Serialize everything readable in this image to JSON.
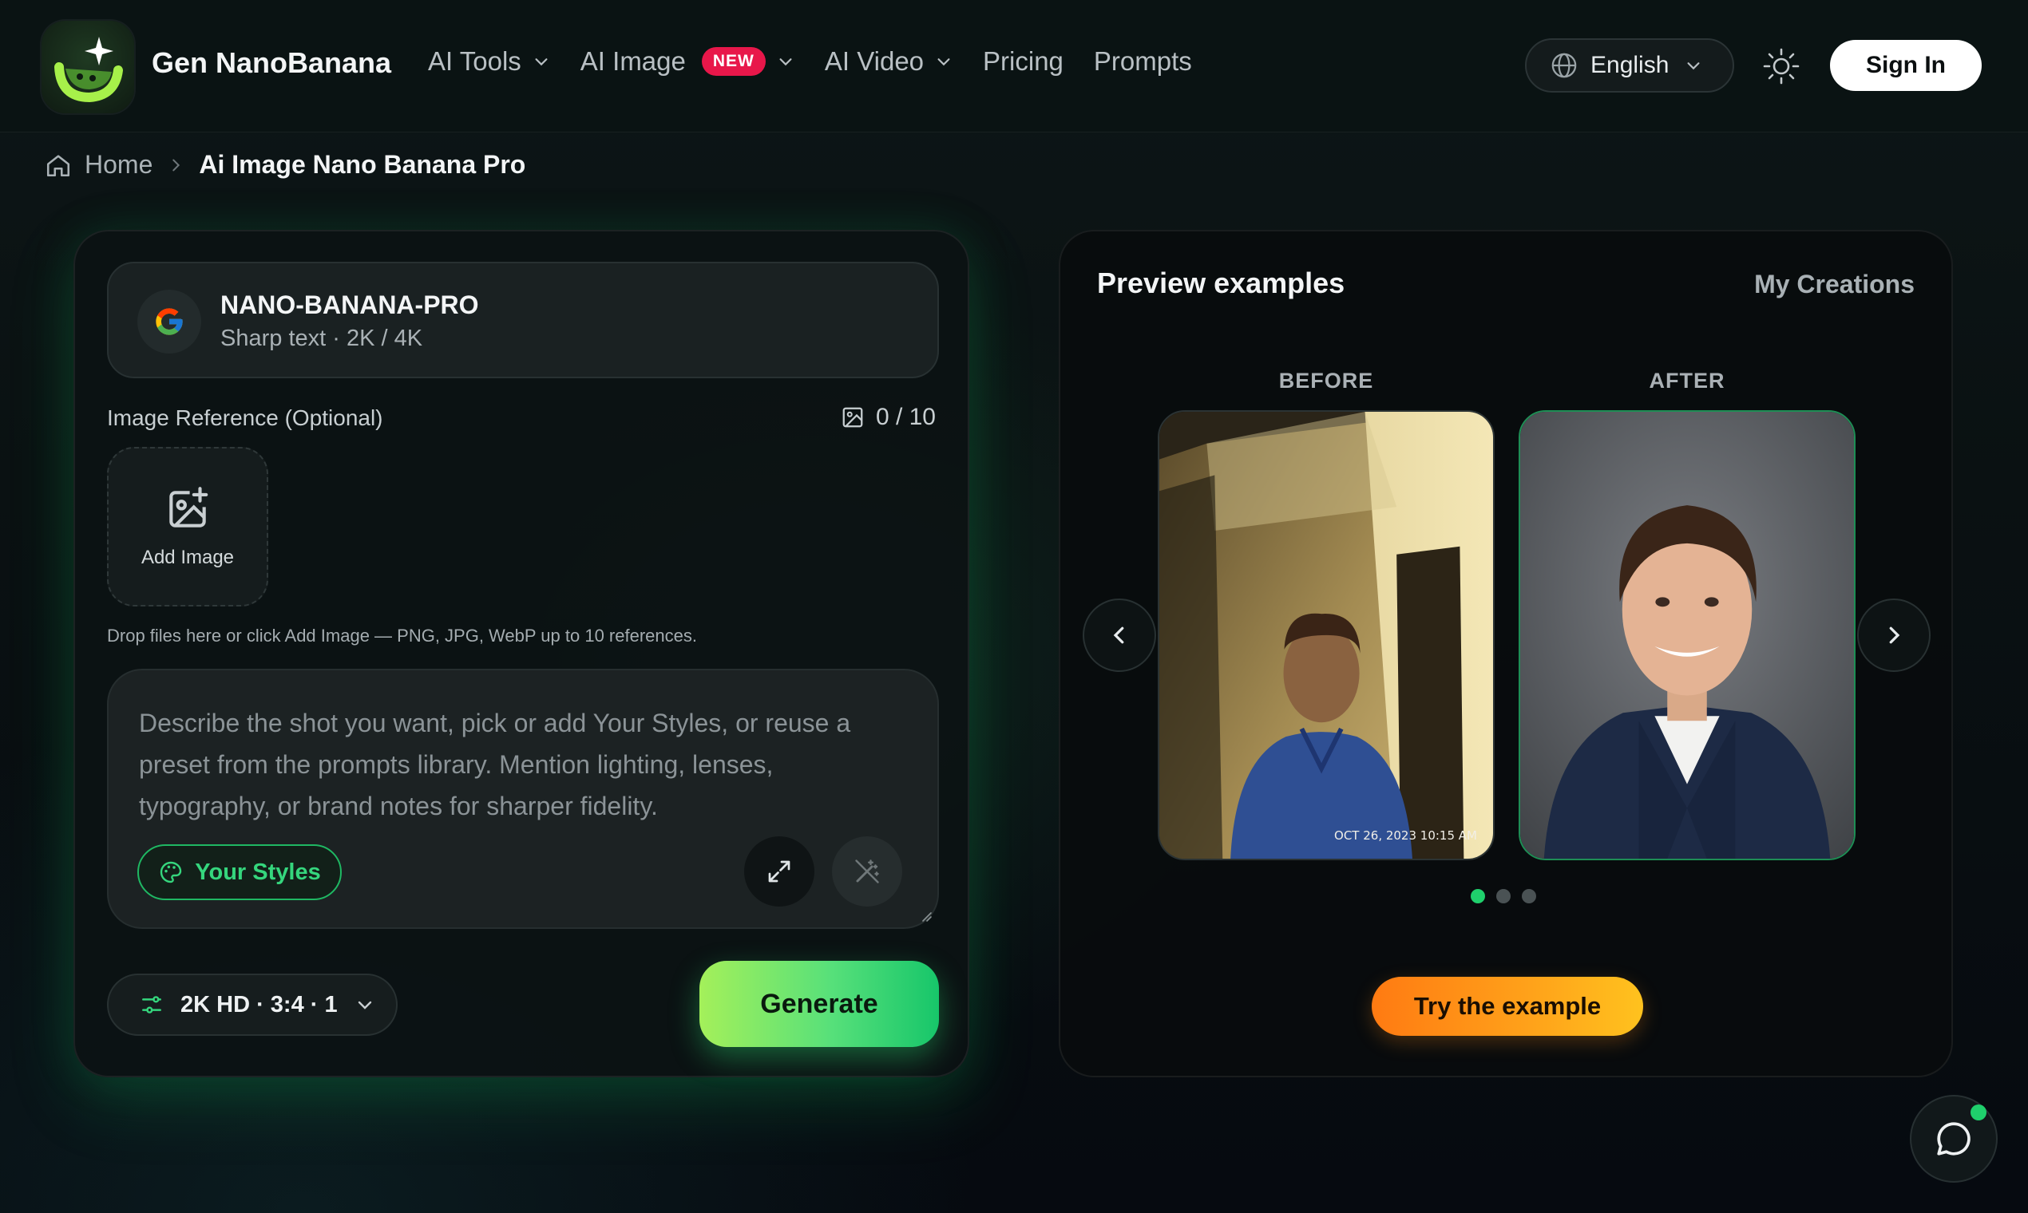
{
  "header": {
    "brand": "Gen NanoBanana",
    "nav": [
      {
        "label": "AI Tools",
        "has_dropdown": true
      },
      {
        "label": "AI Image",
        "badge": "NEW",
        "has_dropdown": true
      },
      {
        "label": "AI Video",
        "has_dropdown": true
      },
      {
        "label": "Pricing"
      },
      {
        "label": "Prompts"
      }
    ],
    "language": "English",
    "sign_in": "Sign In"
  },
  "breadcrumb": {
    "home": "Home",
    "current": "Ai Image Nano Banana Pro"
  },
  "generator": {
    "model": {
      "name": "NANO-BANANA-PRO",
      "subtitle": "Sharp text · 2K / 4K",
      "icon": "google-g-icon"
    },
    "reference": {
      "label": "Image Reference (Optional)",
      "count": "0 / 10",
      "add_label": "Add Image"
    },
    "drop_hint": "Drop files here or click Add Image — PNG, JPG, WebP up to 10 references.",
    "prompt_placeholder": "Describe the shot you want, pick or add Your Styles, or reuse a preset from the prompts library. Mention lighting, lenses, typography, or brand notes for sharper fidelity.",
    "your_styles": "Your Styles",
    "settings": "2K HD · 3:4 · 1",
    "generate": "Generate"
  },
  "preview": {
    "title": "Preview examples",
    "my_creations": "My Creations",
    "before_label": "BEFORE",
    "after_label": "AFTER",
    "photo_stamp": "OCT 26, 2023 10:15 AM",
    "slides": 3,
    "active_slide": 0,
    "try_example": "Try the example"
  },
  "colors": {
    "accent_green": "#1fd06c",
    "new_badge": "#e8174a",
    "try_orange": "#ff9a18"
  }
}
